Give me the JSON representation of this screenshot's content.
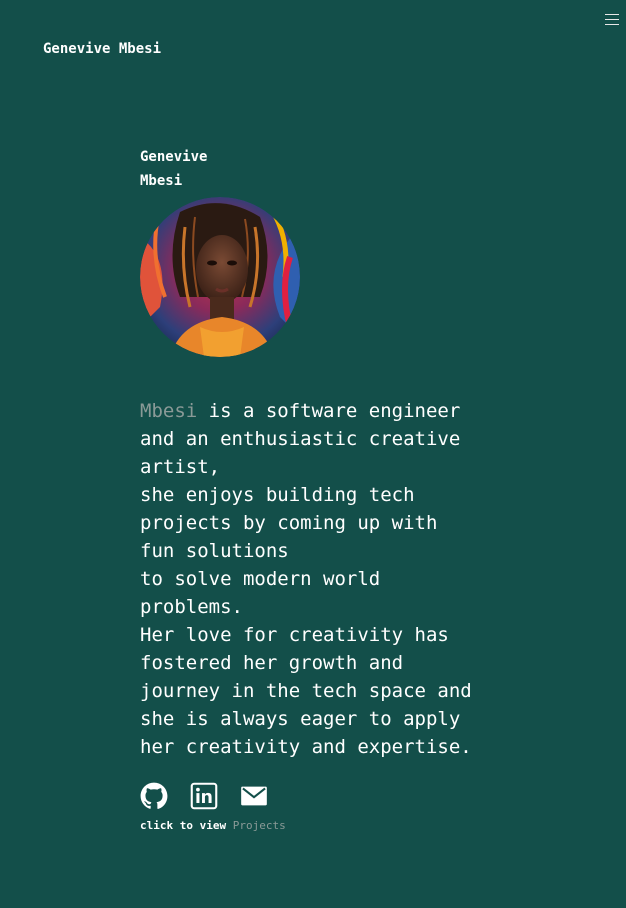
{
  "header": {
    "brand": "Genevive Mbesi",
    "menu_icon": "hamburger-menu-icon"
  },
  "profile": {
    "name_line1": "Genevive",
    "name_line2": "Mbesi",
    "avatar_icon": "profile-portrait"
  },
  "bio": {
    "highlight": "Mbesi",
    "line1_rest": " is a software engineer",
    "line2": "and an enthusiastic creative",
    "line3": "artist,",
    "line4": "she enjoys building tech",
    "line5": "projects by coming up with",
    "line6": "fun solutions",
    "line7": "to solve modern world",
    "line8": "problems.",
    "line9": "Her love for creativity has",
    "line10": "fostered her growth and",
    "line11": "journey in the tech space and",
    "line12": "she is always eager to apply",
    "line13": "her creativity and expertise."
  },
  "socials": [
    {
      "icon": "github-icon"
    },
    {
      "icon": "linkedin-icon"
    },
    {
      "icon": "mail-icon"
    }
  ],
  "footer": {
    "prefix": "click to view ",
    "projects_link": "Projects"
  },
  "colors": {
    "background": "#134f4a",
    "text": "#ffffff",
    "muted": "#8a9a97"
  }
}
